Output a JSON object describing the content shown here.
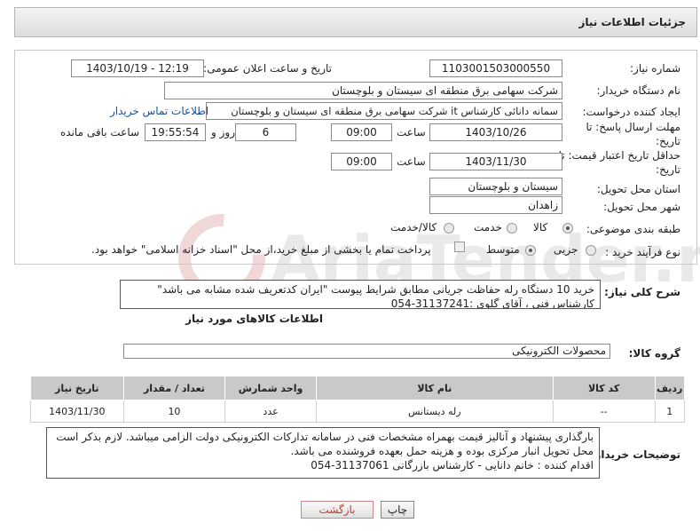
{
  "header": {
    "title": "جزئیات اطلاعات نیاز"
  },
  "form": {
    "need_number_label": "شماره نیاز:",
    "need_number": "1103001503000550",
    "announce_label": "تاریخ و ساعت اعلان عمومی:",
    "announce_value": "1403/10/19 - 12:19",
    "buyer_label": "نام دستگاه خریدار:",
    "buyer_value": "شرکت سهامی برق منطقه ای سیستان و بلوچستان",
    "creator_label": "ایجاد کننده درخواست:",
    "creator_value": "سمانه دانائی کارشناس it شرکت سهامی برق منطقه ای سیستان و بلوچستان",
    "contact_link": "اطلاعات تماس خریدار",
    "deadline_label_1": "مهلت ارسال پاسخ: تا",
    "deadline_label_2": "تاریخ:",
    "deadline_date": "1403/10/26",
    "time_label": "ساعت",
    "deadline_time": "09:00",
    "days_value": "6",
    "days_label": "روز و",
    "remaining_time": "19:55:54",
    "remaining_label": "ساعت باقی مانده",
    "validity_label_1": "حداقل تاریخ اعتبار قیمت: تا",
    "validity_label_2": "تاریخ:",
    "validity_date": "1403/11/30",
    "validity_time_label": "ساعت",
    "validity_time": "09:00",
    "province_label": "استان محل تحویل:",
    "province_value": "سیستان و بلوچستان",
    "city_label": "شهر محل تحویل:",
    "city_value": "زاهدان",
    "category_label": "طبقه بندی موضوعی:",
    "category_options": [
      "کالا",
      "خدمت",
      "کالا/خدمت"
    ],
    "process_label": "نوع فرآیند خرید :",
    "process_options": [
      "جزیی",
      "متوسط"
    ],
    "payment_note": "پرداخت تمام یا بخشی از مبلغ خرید،از محل \"اسناد خزانه اسلامی\" خواهد بود."
  },
  "description": {
    "label": "شرح کلی نیاز:",
    "line1": "خرید 10 دستگاه رله حفاظت جریانی مطابق شرایط پیوست \"ایران کدتعریف شده مشابه می باشد\"",
    "line2": "کارشناس فنی ، آقای گلوی :31137241-054"
  },
  "goods_info": {
    "title": "اطلاعات کالاهای مورد نیاز",
    "group_label": "گروه کالا:",
    "group_value": "محصولات الکترونیکی"
  },
  "table": {
    "headers": [
      "ردیف",
      "کد کالا",
      "نام کالا",
      "واحد شمارش",
      "تعداد / مقدار",
      "تاریخ نیاز"
    ],
    "rows": [
      [
        "1",
        "--",
        "رله دیستانس",
        "عدد",
        "10",
        "1403/11/30"
      ]
    ]
  },
  "buyer_notes": {
    "label": "توضیحات خریدار:",
    "line1": "بارگذاری پیشنهاد و آنالیز قیمت بهمراه مشخصات فنی در سامانه تدارکات الکترونیکی دولت الزامی میباشد. لازم بذکر است",
    "line2": "محل تحویل انبار مرکزی بوده و هزینه حمل بعهده فروشنده می باشد.",
    "line3": "اقدام کننده : خانم دانایی - کارشناس بازرگانی 31137061-054"
  },
  "buttons": {
    "print": "چاپ",
    "back": "بازگشت"
  },
  "watermark": {
    "text": "AriaTender.neT"
  }
}
